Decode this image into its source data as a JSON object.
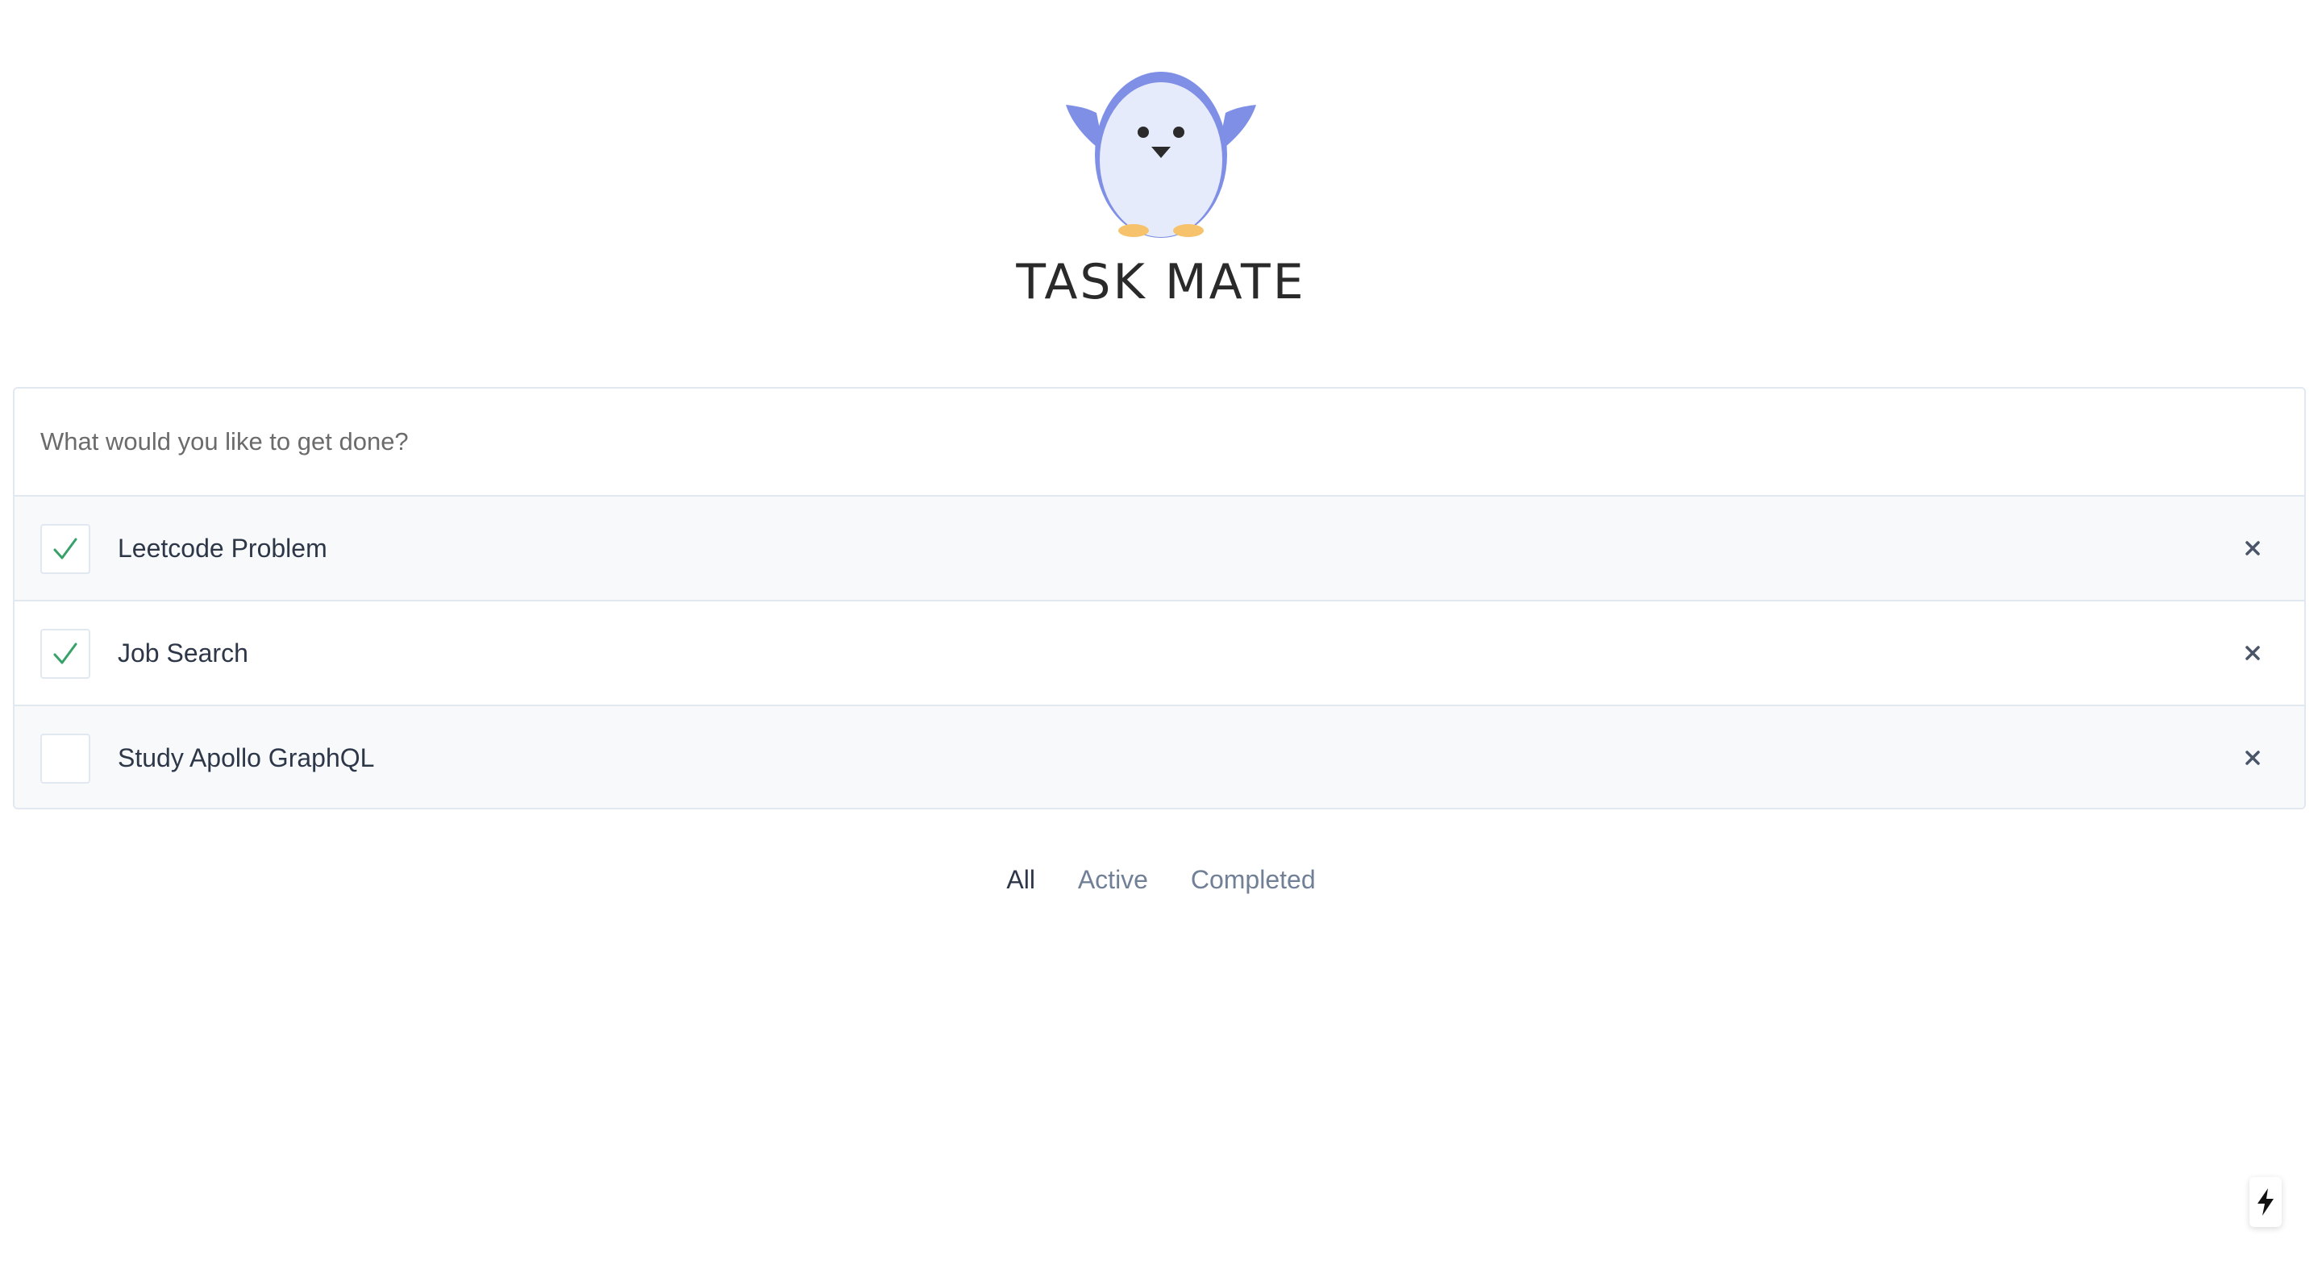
{
  "app": {
    "title": "TASK MATE",
    "logo_icon": "penguin-icon"
  },
  "new_task": {
    "placeholder": "What would you like to get done?",
    "value": ""
  },
  "tasks": [
    {
      "label": "Leetcode Problem",
      "completed": true
    },
    {
      "label": "Job Search",
      "completed": true
    },
    {
      "label": "Study Apollo GraphQL",
      "completed": false
    }
  ],
  "filters": {
    "all": "All",
    "active": "Active",
    "completed": "Completed",
    "selected": "All"
  },
  "icons": {
    "check": "check-icon",
    "delete": "close-icon",
    "bolt": "lightning-bolt-icon"
  },
  "colors": {
    "check": "#38a169",
    "penguin_body": "#7f8fe6",
    "penguin_belly": "#e6ebfb",
    "penguin_feet": "#f6c26b",
    "text": "#2d3748",
    "muted": "#718096",
    "border": "#e2e8f0",
    "row_shade": "#f7f9fb"
  }
}
